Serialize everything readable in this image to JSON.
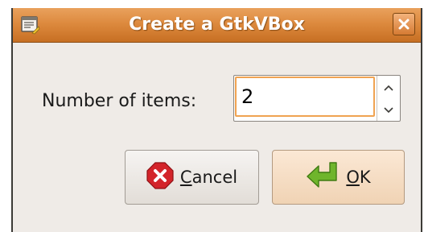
{
  "window": {
    "title": "Create a GtkVBox",
    "close_label": "×"
  },
  "icons": {
    "window_icon": "dialog-window-icon",
    "close": "close-icon",
    "cancel": "stop-x-icon",
    "ok": "green-enter-arrow-icon",
    "spin_up": "chevron-up-icon",
    "spin_down": "chevron-down-icon"
  },
  "form": {
    "items_label": "Number of items:",
    "items_value": "2"
  },
  "buttons": {
    "cancel_mnemonic": "C",
    "cancel_rest": "ancel",
    "ok_mnemonic": "O",
    "ok_rest": "K"
  },
  "colors": {
    "titlebar": "#dd8a3e",
    "focus_border": "#f0a352",
    "ok_button": "#f0d3b4",
    "cancel_icon": "#d3242a",
    "ok_icon": "#6fb52c"
  }
}
